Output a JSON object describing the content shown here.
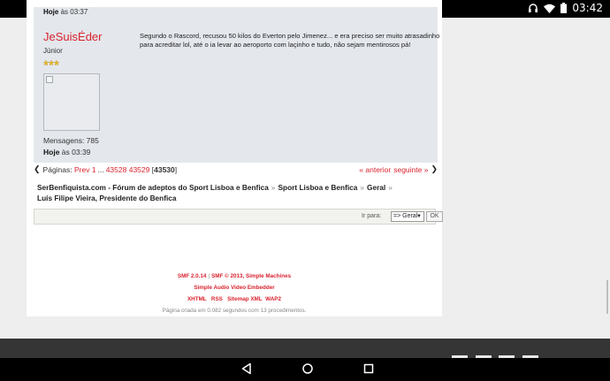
{
  "status_bar": {
    "time": "03:42",
    "icons": [
      "headphones-icon",
      "wifi-icon",
      "battery-icon"
    ]
  },
  "post": {
    "prev_time_label": "Hoje",
    "prev_time_suffix": "às 03:37",
    "poster_name": "JeSuisÉder",
    "poster_rank": "Júnior",
    "stars": 3,
    "posts_count": "Mensagens: 785",
    "time_label": "Hoje",
    "time_suffix": "às 03:39",
    "body": "Segundo o Rascord, recusou 50 kilos do Everton pelo Jimenez... e era preciso ser muito atrasadinho para acreditar lol, até o ia levar ao aeroporto com laçinho e tudo, não sejam mentirosos pá!"
  },
  "pagination": {
    "label": "Páginas:",
    "prev": "Prev",
    "first": "1",
    "dots": "...",
    "pages": [
      "43528",
      "43529"
    ],
    "current": "43530",
    "prev_topic": "« anterior",
    "next_topic": "seguinte »"
  },
  "breadcrumb": {
    "items": [
      "SerBenfiquista.com - Fórum de adeptos do Sport Lisboa e Benfica",
      "Sport Lisboa e Benfica",
      "Geral"
    ],
    "topic": "Luís Filipe Vieira, Presidente do Benfica",
    "separator": "»"
  },
  "jump": {
    "label": "Ir para:",
    "selected": "=> Geral",
    "ok": "OK"
  },
  "footer": {
    "smf_version": "SMF 2.0.14",
    "smf_copyright": "SMF © 2013, Simple Machines",
    "plugin": "Simple Audio Video Embedder",
    "links": [
      "XHTML",
      "RSS",
      "Sitemap XML",
      "WAP2"
    ],
    "stats": "Página criada em 0.082 segundos com 13 procedimentos."
  },
  "colors": {
    "accent": "#d9232e",
    "post_bg": "#e4e7ec",
    "page_bg": "#eeeeee"
  }
}
